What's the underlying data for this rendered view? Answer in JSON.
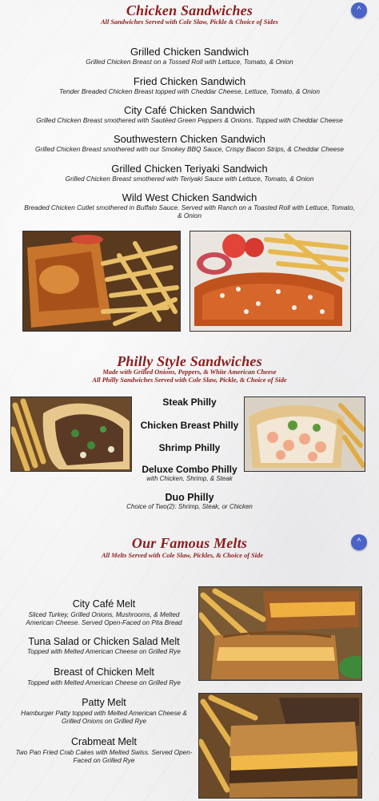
{
  "chicken": {
    "title": "Chicken Sandwiches",
    "subtitle": "All Sandwiches Served with Cole Slaw, Pickle & Choice of Sides",
    "items": [
      {
        "name": "Grilled Chicken Sandwich",
        "desc": "Grilled Chicken Breast on a Tossed Roll with Lettuce, Tomato, & Onion"
      },
      {
        "name": "Fried Chicken Sandwich",
        "desc": "Tender Breaded Chicken Breast topped with Cheddar Cheese, Lettuce, Tomato, & Onion"
      },
      {
        "name": "City Café Chicken Sandwich",
        "desc": "Grilled Chicken Breast smothered with Sautéed Green Peppers & Onions. Topped with Cheddar Cheese"
      },
      {
        "name": "Southwestern Chicken Sandwich",
        "desc": "Grilled Chicken Breast smothered with our Smokey BBQ Sauce, Crispy Bacon Strips, & Cheddar Cheese"
      },
      {
        "name": "Grilled Chicken Teriyaki Sandwich",
        "desc": "Grilled Chicken Breast smothered with Teriyaki Sauce with Lettuce, Tomato, & Onion"
      },
      {
        "name": "Wild West Chicken Sandwich",
        "desc": "Breaded Chicken Cutlet smothered in Buffalo Sauce. Served with Ranch on a Toasted Roll with Lettuce, Tomato, & Onion"
      }
    ]
  },
  "philly": {
    "title": "Philly Style Sandwiches",
    "subtitle_line1": "Made with Grilled Onions, Peppers, & White American Cheese",
    "subtitle_line2": "All Philly Sandwiches Served with Cole Slaw, Pickle, & Choice of Side",
    "items": [
      {
        "name": "Steak Philly",
        "desc": ""
      },
      {
        "name": "Chicken Breast Philly",
        "desc": ""
      },
      {
        "name": "Shrimp Philly",
        "desc": ""
      },
      {
        "name": "Deluxe Combo Philly",
        "desc": "with Chicken, Shrimp, & Steak"
      },
      {
        "name": "Duo Philly",
        "desc": "Choice of Two(2): Shrimp, Steak, or Chicken"
      }
    ]
  },
  "melts": {
    "title": "Our Famous Melts",
    "subtitle": "All Melts Served with Cole Slaw, Pickles, & Choice of Side",
    "items": [
      {
        "name": "City Café Melt",
        "desc": "Sliced Turkey, Grilled Onions, Mushrooms, & Melted American Cheese. Served Open-Faced on Pita Bread"
      },
      {
        "name": "Tuna Salad or Chicken Salad Melt",
        "desc": "Topped with Melted American Cheese on Grilled Rye"
      },
      {
        "name": "Breast of Chicken Melt",
        "desc": "Topped with Melted American Cheese on Grilled Rye"
      },
      {
        "name": "Patty Melt",
        "desc": "Hamburger Patty topped with Melted American Cheese & Grilled Onions on Grilled Rye"
      },
      {
        "name": "Crabmeat Melt",
        "desc": "Two Pan Fried Crab Cakes with Melted Swiss. Served Open-Faced on Grilled Rye"
      }
    ]
  },
  "ui": {
    "scroll_top_glyph": "^",
    "accent_color": "#8c1d1d",
    "button_color": "#4a63c7"
  },
  "photos": {
    "chicken_left": "fried-chicken-sandwich-with-fries-photo",
    "chicken_right": "buffalo-chicken-sandwich-with-fries-photo",
    "philly_left": "steak-philly-with-fries-photo",
    "philly_right": "shrimp-philly-with-fries-photo",
    "melt_top": "tuna-melt-with-fries-photo",
    "melt_bottom": "patty-melt-with-fries-photo"
  }
}
